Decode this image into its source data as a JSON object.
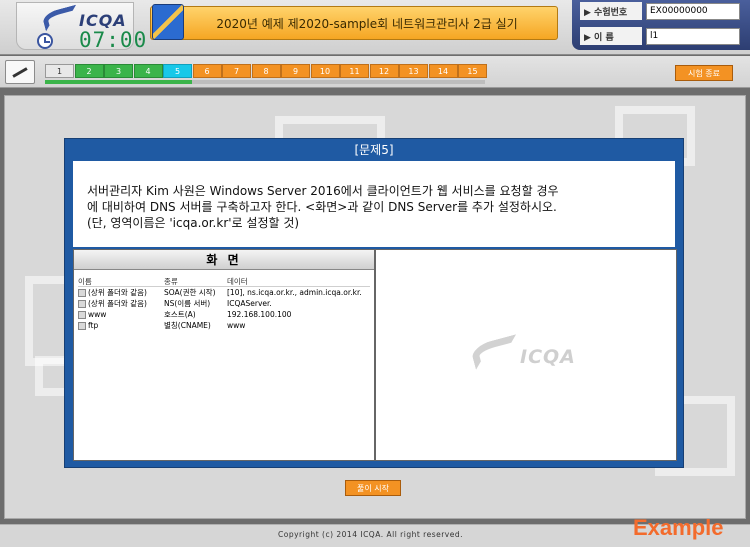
{
  "header": {
    "logo_text": "ICQA",
    "timer": "07:00",
    "title": "2020년 예제 제2020-sample회 네트워크관리사 2급 실기",
    "exam_number_label": "▶ 수험번호",
    "exam_number_value": "EX00000000",
    "name_label": "▶ 이    름",
    "name_value": "l1"
  },
  "progress": {
    "questions": [
      {
        "label": "1",
        "state": "gray"
      },
      {
        "label": "2",
        "state": "green"
      },
      {
        "label": "3",
        "state": "green"
      },
      {
        "label": "4",
        "state": "green"
      },
      {
        "label": "5",
        "state": "cyan"
      },
      {
        "label": "6",
        "state": "orange"
      },
      {
        "label": "7",
        "state": "orange"
      },
      {
        "label": "8",
        "state": "orange"
      },
      {
        "label": "9",
        "state": "orange"
      },
      {
        "label": "10",
        "state": "orange"
      },
      {
        "label": "11",
        "state": "orange"
      },
      {
        "label": "12",
        "state": "orange"
      },
      {
        "label": "13",
        "state": "orange"
      },
      {
        "label": "14",
        "state": "orange"
      },
      {
        "label": "15",
        "state": "orange"
      }
    ],
    "completed_fraction": 0.333,
    "end_button": "시험 종료"
  },
  "question": {
    "header": "[문제5]",
    "line1": "서버관리자 Kim 사원은 Windows Server 2016에서 클라이언트가 웹 서비스를 요청할 경우",
    "line2": "에 대비하여 DNS 서버를 구축하고자 한다. <화면>과 같이 DNS Server를 추가 설정하시오.",
    "line3": "(단, 영역이름은 'icqa.or.kr'로 설정할 것)"
  },
  "screen": {
    "title": "화 면",
    "columns": [
      "이름",
      "종류",
      "데이터"
    ],
    "rows": [
      {
        "name": "(상위 폴더와 같음)",
        "type": "SOA(권한 시작)",
        "data": "[10], ns.icqa.or.kr., admin.icqa.or.kr."
      },
      {
        "name": "(상위 폴더와 같음)",
        "type": "NS(이름 서버)",
        "data": "ICQAServer."
      },
      {
        "name": "www",
        "type": "호스트(A)",
        "data": "192.168.100.100"
      },
      {
        "name": "ftp",
        "type": "별칭(CNAME)",
        "data": "www"
      }
    ]
  },
  "watermark_text": "ICQA",
  "start_button": "풀이 시작",
  "copyright": "Copyright (c) 2014 ICQA. All right reserved.",
  "example_label": "Example"
}
